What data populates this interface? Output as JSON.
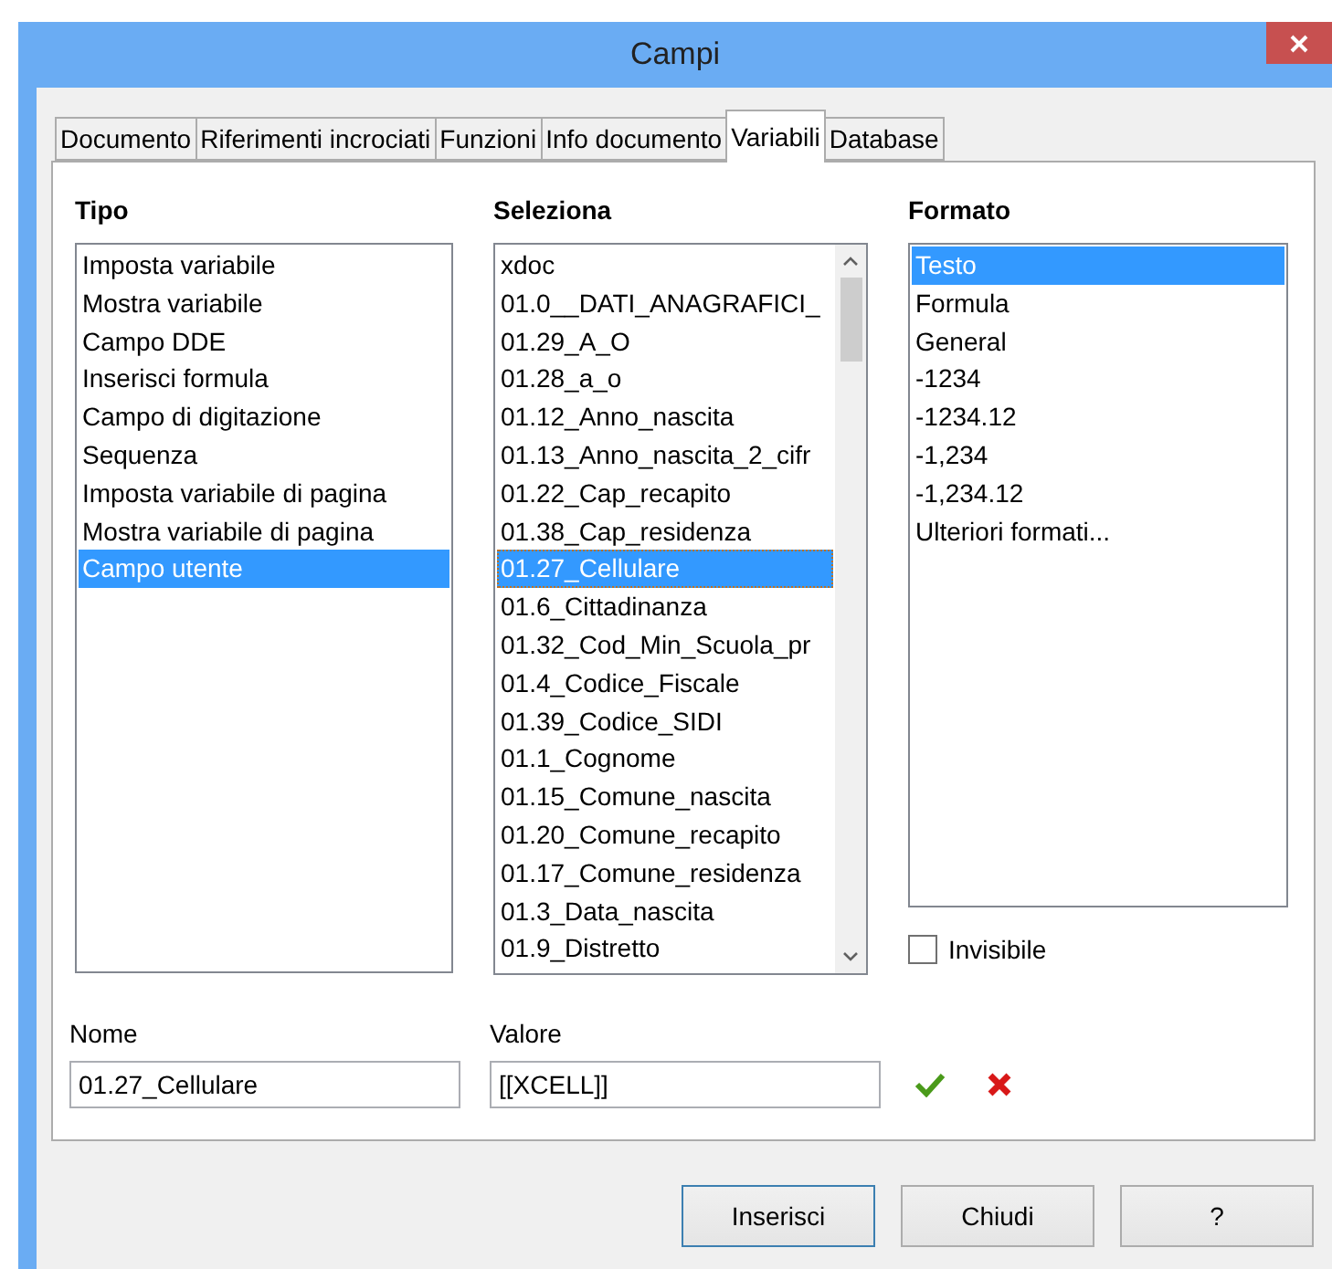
{
  "window": {
    "title": "Campi"
  },
  "tabs": [
    {
      "label": "Documento",
      "selected": false
    },
    {
      "label": "Riferimenti incrociati",
      "selected": false
    },
    {
      "label": "Funzioni",
      "selected": false
    },
    {
      "label": "Info documento",
      "selected": false
    },
    {
      "label": "Variabili",
      "selected": true
    },
    {
      "label": "Database",
      "selected": false
    }
  ],
  "tipo": {
    "heading": "Tipo",
    "items": [
      {
        "label": "Imposta variabile",
        "selected": false
      },
      {
        "label": "Mostra variabile",
        "selected": false
      },
      {
        "label": "Campo DDE",
        "selected": false
      },
      {
        "label": "Inserisci formula",
        "selected": false
      },
      {
        "label": "Campo di digitazione",
        "selected": false
      },
      {
        "label": "Sequenza",
        "selected": false
      },
      {
        "label": "Imposta variabile di pagina",
        "selected": false
      },
      {
        "label": "Mostra variabile di pagina",
        "selected": false
      },
      {
        "label": "Campo utente",
        "selected": true
      }
    ]
  },
  "seleziona": {
    "heading": "Seleziona",
    "items": [
      {
        "label": "xdoc",
        "selected": false
      },
      {
        "label": "01.0__DATI_ANAGRAFICI_",
        "selected": false
      },
      {
        "label": "01.29_A_O",
        "selected": false
      },
      {
        "label": "01.28_a_o",
        "selected": false
      },
      {
        "label": "01.12_Anno_nascita",
        "selected": false
      },
      {
        "label": "01.13_Anno_nascita_2_cifr",
        "selected": false
      },
      {
        "label": "01.22_Cap_recapito",
        "selected": false
      },
      {
        "label": "01.38_Cap_residenza",
        "selected": false
      },
      {
        "label": "01.27_Cellulare",
        "selected": true
      },
      {
        "label": "01.6_Cittadinanza",
        "selected": false
      },
      {
        "label": "01.32_Cod_Min_Scuola_pr",
        "selected": false
      },
      {
        "label": "01.4_Codice_Fiscale",
        "selected": false
      },
      {
        "label": "01.39_Codice_SIDI",
        "selected": false
      },
      {
        "label": "01.1_Cognome",
        "selected": false
      },
      {
        "label": "01.15_Comune_nascita",
        "selected": false
      },
      {
        "label": "01.20_Comune_recapito",
        "selected": false
      },
      {
        "label": "01.17_Comune_residenza",
        "selected": false
      },
      {
        "label": "01.3_Data_nascita",
        "selected": false
      },
      {
        "label": "01.9_Distretto",
        "selected": false
      }
    ]
  },
  "formato": {
    "heading": "Formato",
    "items": [
      {
        "label": "Testo",
        "selected": true
      },
      {
        "label": "Formula",
        "selected": false
      },
      {
        "label": "General",
        "selected": false
      },
      {
        "label": "-1234",
        "selected": false
      },
      {
        "label": "-1234.12",
        "selected": false
      },
      {
        "label": "-1,234",
        "selected": false
      },
      {
        "label": "-1,234.12",
        "selected": false
      },
      {
        "label": "Ulteriori formati...",
        "selected": false
      }
    ]
  },
  "invisibile": {
    "label": "Invisibile",
    "checked": false
  },
  "nome": {
    "label": "Nome",
    "value": "01.27_Cellulare"
  },
  "valore": {
    "label": "Valore",
    "value": "[[XCELL]]"
  },
  "buttons": [
    {
      "label": "Inserisci",
      "default": true
    },
    {
      "label": "Chiudi",
      "default": false
    },
    {
      "label": "?",
      "default": false
    }
  ]
}
